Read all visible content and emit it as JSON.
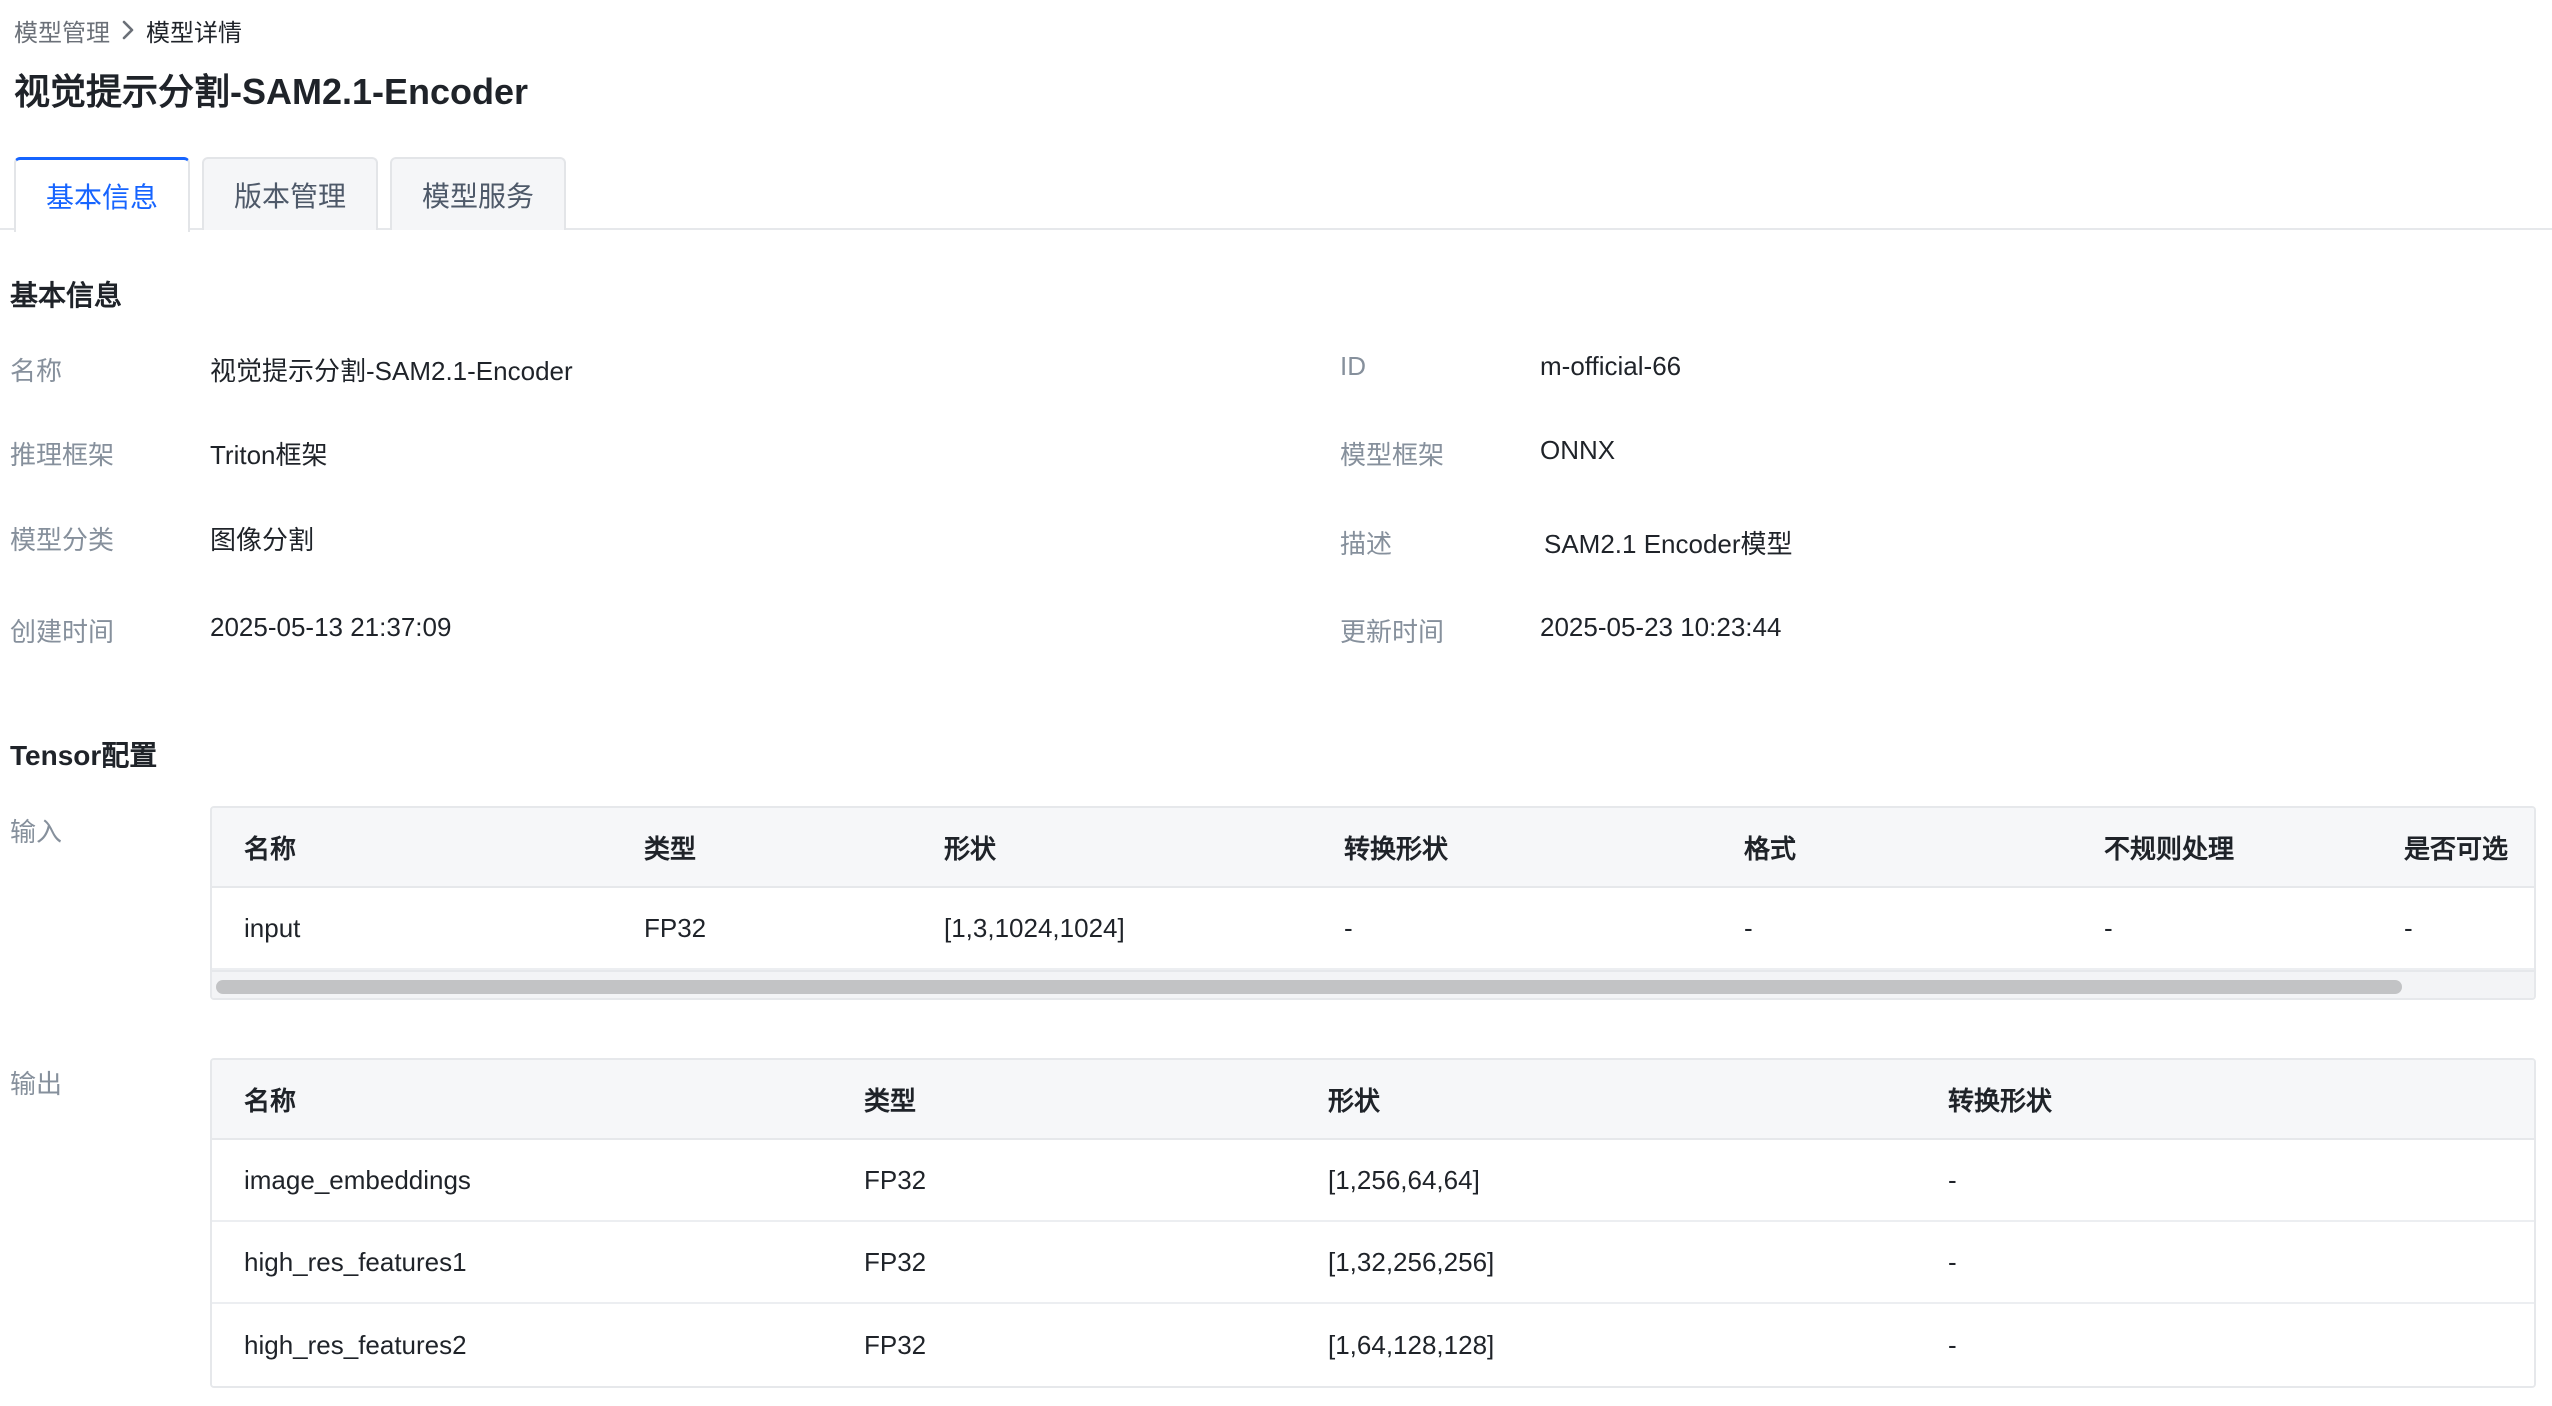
{
  "breadcrumb": {
    "parent": "模型管理",
    "current": "模型详情"
  },
  "page": {
    "title": "视觉提示分割-SAM2.1-Encoder"
  },
  "tabs": [
    {
      "label": "基本信息",
      "active": true
    },
    {
      "label": "版本管理",
      "active": false
    },
    {
      "label": "模型服务",
      "active": false
    }
  ],
  "basic": {
    "section_title": "基本信息",
    "fields": {
      "name": {
        "label": "名称",
        "value": "视觉提示分割-SAM2.1-Encoder"
      },
      "id": {
        "label": "ID",
        "value": "m-official-66"
      },
      "infer_framework": {
        "label": "推理框架",
        "value": "Triton框架"
      },
      "model_framework": {
        "label": "模型框架",
        "value": "ONNX"
      },
      "category": {
        "label": "模型分类",
        "value": "图像分割"
      },
      "description": {
        "label": "描述",
        "value": "SAM2.1 Encoder模型"
      },
      "created": {
        "label": "创建时间",
        "value": "2025-05-13 21:37:09"
      },
      "updated": {
        "label": "更新时间",
        "value": "2025-05-23 10:23:44"
      }
    }
  },
  "tensor": {
    "section_title": "Tensor配置",
    "input": {
      "label": "输入",
      "columns": [
        "名称",
        "类型",
        "形状",
        "转换形状",
        "格式",
        "不规则处理",
        "是否可选"
      ],
      "rows": [
        [
          "input",
          "FP32",
          "[1,3,1024,1024]",
          "-",
          "-",
          "-",
          "-"
        ]
      ]
    },
    "output": {
      "label": "输出",
      "columns": [
        "名称",
        "类型",
        "形状",
        "转换形状"
      ],
      "rows": [
        [
          "image_embeddings",
          "FP32",
          "[1,256,64,64]",
          "-"
        ],
        [
          "high_res_features1",
          "FP32",
          "[1,32,256,256]",
          "-"
        ],
        [
          "high_res_features2",
          "FP32",
          "[1,64,128,128]",
          "-"
        ]
      ]
    }
  },
  "colors": {
    "accent": "#1664ff",
    "label_gray": "#86909c",
    "header_bg": "#f6f7f9"
  }
}
